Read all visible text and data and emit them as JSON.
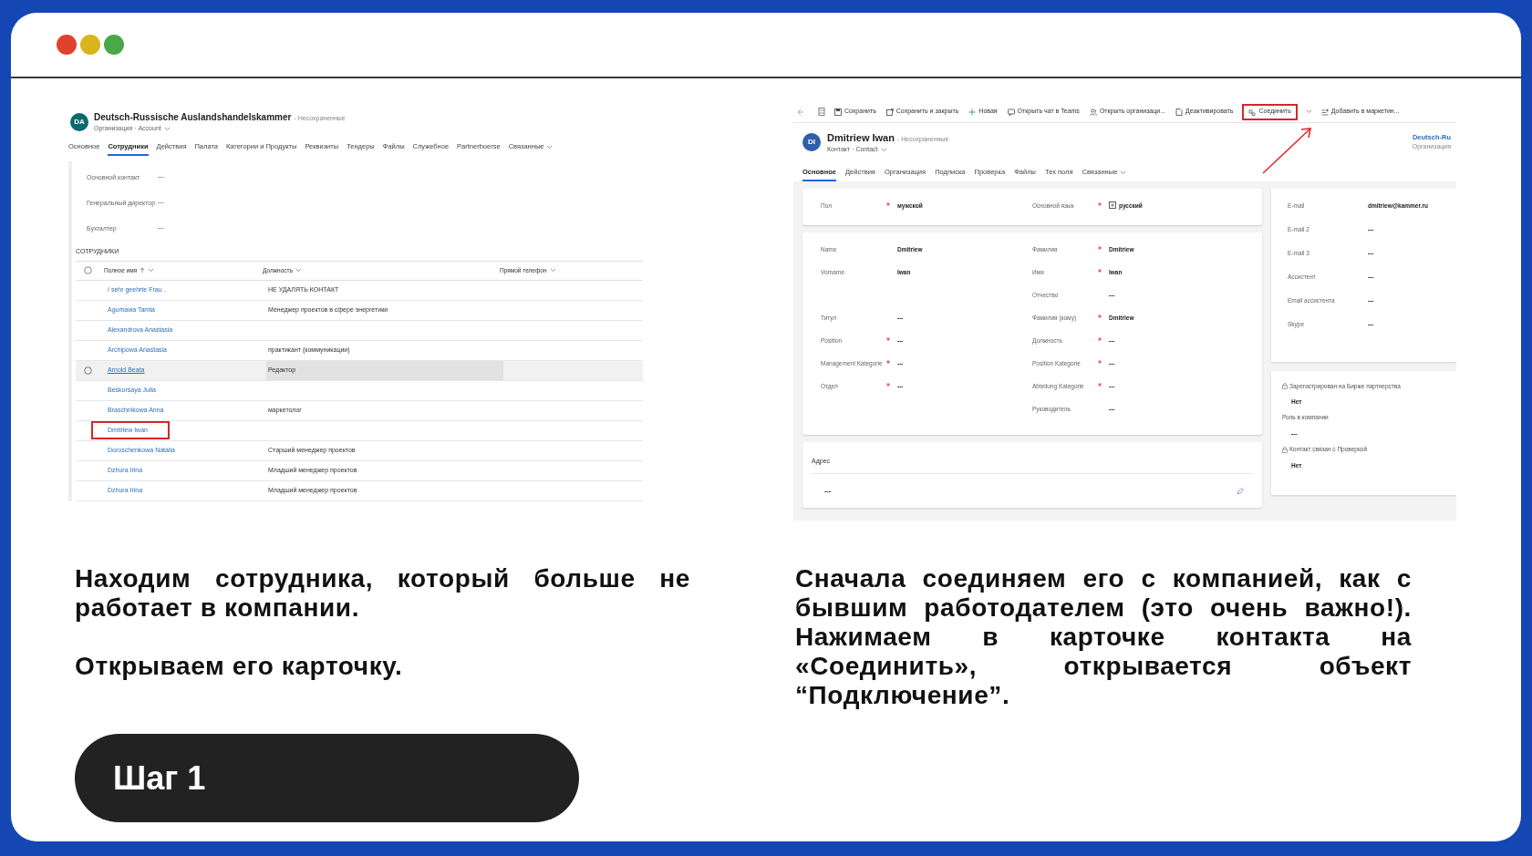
{
  "left_screenshot": {
    "avatar": "DA",
    "title": "Deutsch-Russische Auslandshandelskammer",
    "status": "- Несохраненные",
    "subtitle": "Организация · Account",
    "tabs": [
      {
        "label": "Основное",
        "selected": false,
        "dropdown": false
      },
      {
        "label": "Сотрудники",
        "selected": true,
        "dropdown": false
      },
      {
        "label": "Действия",
        "selected": false,
        "dropdown": false
      },
      {
        "label": "Палата",
        "selected": false,
        "dropdown": false
      },
      {
        "label": "Категории и Продукты",
        "selected": false,
        "dropdown": false
      },
      {
        "label": "Реквизиты",
        "selected": false,
        "dropdown": false
      },
      {
        "label": "Тендеры",
        "selected": false,
        "dropdown": false
      },
      {
        "label": "Файлы",
        "selected": false,
        "dropdown": false
      },
      {
        "label": "Служебное",
        "selected": false,
        "dropdown": false
      },
      {
        "label": "Partnerboerse",
        "selected": false,
        "dropdown": false
      },
      {
        "label": "Связанные",
        "selected": false,
        "dropdown": true
      }
    ],
    "fields": [
      {
        "label": "Основной контакт",
        "value": "---"
      },
      {
        "label": "Генеральный директор",
        "value": "---"
      },
      {
        "label": "Бухгалтер",
        "value": "---"
      }
    ],
    "section_title": "СОТРУДНИКИ",
    "columns": [
      {
        "label": "Полное имя",
        "sorted": true
      },
      {
        "label": "Должность",
        "sorted": false
      },
      {
        "label": "Прямой телефон",
        "sorted": false
      }
    ],
    "rows": [
      {
        "name": "/ sehr geehrte Frau .",
        "position": "НЕ УДАЛЯТЬ КОНТАКТ",
        "hovered": false,
        "outlined": false
      },
      {
        "name": "Agumawa Tamta",
        "position": "Менеджер проектов в сфере энергетики",
        "hovered": false,
        "outlined": false
      },
      {
        "name": "Alexandrova Anastasia",
        "hovered": false,
        "outlined": false
      },
      {
        "name": "Archipowa Anastasia",
        "position": "практикант (коммуникации)",
        "hovered": false,
        "outlined": false
      },
      {
        "name": "Arnold Beata",
        "position": "Редактор",
        "hovered": true,
        "outlined": false
      },
      {
        "name": "Beskorsaya Julia",
        "hovered": false,
        "outlined": false
      },
      {
        "name": "Braschnikowa Anna",
        "position": "маркетолог",
        "hovered": false,
        "outlined": false
      },
      {
        "name": "Dmitriew Iwan",
        "hovered": false,
        "outlined": true
      },
      {
        "name": "Doroschenkowa Natalia",
        "position": "Старший менеджер проектов",
        "hovered": false,
        "outlined": false
      },
      {
        "name": "Dzhura Irina",
        "position": "Младший менеджер проектов",
        "hovered": false,
        "outlined": false
      },
      {
        "name": "Dzhura Irina",
        "position": "Младший менеджер проектов",
        "hovered": false,
        "outlined": false
      }
    ]
  },
  "right_screenshot": {
    "toolbar": [
      {
        "kind": "button",
        "label": "Сохранить",
        "outlined": false
      },
      {
        "kind": "button",
        "label": "Сохранить и закрыть",
        "outlined": false
      },
      {
        "kind": "button",
        "label": "Новая",
        "outlined": false
      },
      {
        "kind": "button",
        "label": "Открыть чат в Teams",
        "outlined": false
      },
      {
        "kind": "button",
        "label": "Открыть организаци...",
        "outlined": false
      },
      {
        "kind": "button",
        "label": "Деактивировать",
        "outlined": false
      },
      {
        "kind": "button",
        "label": "Соединить",
        "outlined": true
      },
      {
        "kind": "caret"
      },
      {
        "kind": "button",
        "label": "Добавить в маркетин...",
        "outlined": false
      }
    ],
    "avatar": "DI",
    "title": "Dmitriew Iwan",
    "status": "- Несохраненные",
    "subtitle": "Контакт · Contact",
    "parent_link": "Deutsch-Ru",
    "parent_type": "Организация",
    "tabs": [
      {
        "label": "Основное",
        "selected": true,
        "dropdown": false
      },
      {
        "label": "Действия",
        "selected": false,
        "dropdown": false
      },
      {
        "label": "Организация",
        "selected": false,
        "dropdown": false
      },
      {
        "label": "Подписка",
        "selected": false,
        "dropdown": false
      },
      {
        "label": "Проверка",
        "selected": false,
        "dropdown": false
      },
      {
        "label": "Файлы",
        "selected": false,
        "dropdown": false
      },
      {
        "label": "Тех поля",
        "selected": false,
        "dropdown": false
      },
      {
        "label": "Связанные",
        "selected": false,
        "dropdown": true
      }
    ],
    "top_card": [
      {
        "label": "Пол",
        "required": true,
        "value": "мужской",
        "language_icon": false
      },
      {
        "label": "Основной язык",
        "required": true,
        "value": "русский",
        "language_icon": true
      }
    ],
    "details_left": [
      {
        "kind": "field",
        "label": "Name",
        "required": false,
        "value": "Dmitriew"
      },
      {
        "kind": "field",
        "label": "Vorname",
        "required": false,
        "value": "Iwan"
      },
      {
        "kind": "gap"
      },
      {
        "kind": "field",
        "label": "Титул",
        "required": false,
        "value": "---"
      },
      {
        "kind": "field",
        "label": "Position",
        "required": true,
        "value": "---"
      },
      {
        "kind": "field",
        "label": "Management Kategorie",
        "required": true,
        "value": "---"
      },
      {
        "kind": "field",
        "label": "Отдел",
        "required": true,
        "value": "---"
      }
    ],
    "details_right": [
      {
        "kind": "field",
        "label": "Фамилия",
        "required": true,
        "value": "Dmitriew"
      },
      {
        "kind": "field",
        "label": "Имя",
        "required": true,
        "value": "Iwan"
      },
      {
        "kind": "field",
        "label": "Отчество",
        "required": false,
        "value": "---"
      },
      {
        "kind": "field",
        "label": "Фамилия (кому)",
        "required": true,
        "value": "Dmitriew"
      },
      {
        "kind": "field",
        "label": "Должность",
        "required": true,
        "value": "---"
      },
      {
        "kind": "field",
        "label": "Position Kategorie",
        "required": true,
        "value": "---"
      },
      {
        "kind": "field",
        "label": "Abteilung Kategorie",
        "required": true,
        "value": "---"
      },
      {
        "kind": "field",
        "label": "Руководитель",
        "required": false,
        "value": "---"
      }
    ],
    "address": {
      "title": "Адрес",
      "value": "---"
    },
    "contact_card": [
      {
        "label": "E-mail",
        "value": "dmitriew@kammer.ru"
      },
      {
        "label": "E-mail 2",
        "value": "---"
      },
      {
        "label": "E-mail 3",
        "value": "---"
      },
      {
        "label": "Ассистент",
        "value": "---"
      },
      {
        "label": "Email ассистента",
        "value": "---"
      },
      {
        "label": "Skype",
        "value": "---"
      }
    ],
    "flags_card": [
      {
        "label": "Зарегистрирован на Бирже партнерства",
        "locked": true,
        "value": "Нет"
      },
      {
        "label": "Роль в компании",
        "locked": false,
        "value": "---"
      },
      {
        "label": "Контакт связан с Проверкой",
        "locked": true,
        "value": "Нет"
      }
    ]
  },
  "left_caption": [
    "Находим сотрудника, который больше не работает в компании.",
    "Открываем его карточку."
  ],
  "right_caption": "Сначала соединяем его с компанией, как с бывшим работодателем (это очень важно!). Нажимаем в карточке контакта на «Соединить», открывается объект “Подключение”.",
  "step": "Шаг 1"
}
